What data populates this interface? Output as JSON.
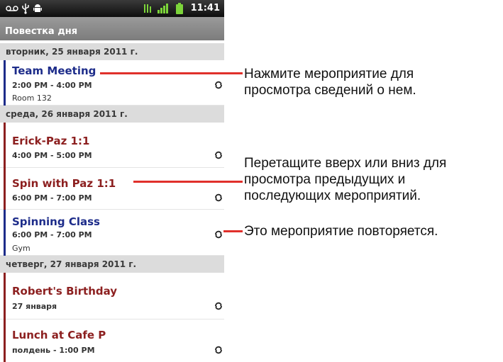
{
  "status_bar": {
    "time": "11:41",
    "icons": [
      "voicemail-icon",
      "usb-icon",
      "android-debug-icon",
      "3g-data-icon",
      "signal-icon",
      "battery-icon"
    ],
    "colors": {
      "accent_green": "#7cd43a",
      "bar": "#141414"
    }
  },
  "title_bar": {
    "title": "Повестка дня"
  },
  "days": [
    {
      "header": "вторник, 25 января 2011 г.",
      "events": [
        {
          "title": "Team Meeting",
          "time": "2:00 PM - 4:00 PM",
          "location": "Room 132",
          "color": "#1d2c8a",
          "repeat_icon": "repeat-icon"
        }
      ]
    },
    {
      "header": "среда, 26 января 2011 г.",
      "events": [
        {
          "title": "Erick-Paz 1:1",
          "time": "4:00 PM - 5:00 PM",
          "location": "",
          "color": "#8c1f1f",
          "repeat_icon": "repeat-icon"
        },
        {
          "title": "Spin with Paz 1:1",
          "time": "6:00 PM - 7:00 PM",
          "location": "",
          "color": "#8c1f1f",
          "repeat_icon": "repeat-icon"
        },
        {
          "title": "Spinning Class",
          "time": "6:00 PM - 7:00 PM",
          "location": "Gym",
          "color": "#1d2c8a",
          "repeat_icon": "repeat-icon"
        }
      ]
    },
    {
      "header": "четверг, 27 января 2011 г.",
      "events": [
        {
          "title": "Robert's Birthday",
          "time": "27 января",
          "location": "",
          "color": "#8c1f1f",
          "repeat_icon": "repeat-icon"
        },
        {
          "title": "Lunch at Cafe P",
          "time": "полдень - 1:00 PM",
          "location": "",
          "color": "#8c1f1f",
          "repeat_icon": "repeat-icon"
        }
      ]
    }
  ],
  "callouts": [
    {
      "lines": [
        "Нажмите мероприятие для",
        "просмотра сведений о нем."
      ]
    },
    {
      "lines": [
        "Перетащите вверх или вниз для",
        "просмотра предыдущих и",
        "последующих мероприятий."
      ]
    },
    {
      "lines": [
        "Это мероприятие повторяется."
      ]
    }
  ],
  "colors": {
    "callout_line": "#e0302b",
    "day_header_bg": "#dcdcdc",
    "title_bar_bg": "#8a8a8a"
  }
}
